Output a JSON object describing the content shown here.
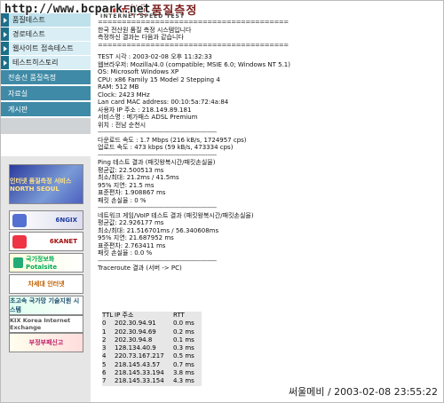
{
  "watermark": "http://www.bcpark.net",
  "logo": {
    "korean_title": "터넷 품질측정",
    "subtitle": "INTERNET SPEED TEST"
  },
  "nav": {
    "items": [
      {
        "label": "품질테스트"
      },
      {
        "label": "경로테스트"
      },
      {
        "label": "웹사이트 접속테스트"
      },
      {
        "label": "테스트히스토리"
      }
    ],
    "sections": [
      "전송선 품질측정",
      "자료실",
      "게시판"
    ]
  },
  "banners": [
    "인터넷 품질측정 서비스 NORTH SEOUL",
    "6NGIX",
    "6KANET",
    "국가정보화 Potalsite",
    "차세대 인터넷",
    "초고속 국가망 기술지원 시스템",
    "KIX Korea Internet Exchange",
    "부정부패신고"
  ],
  "content": {
    "sep": "========================================",
    "dash": "------------------------------------------------------------------",
    "intro": [
      "한국 전산원 품질 측정 시스템입니다",
      "측정하신 결과는 다음과 같습니다"
    ],
    "sysinfo": [
      "TEST 시각 : 2003-02-08 오후 11:32:33",
      "웹브라우저: Mozilla/4.0 (compatible; MSIE 6.0; Windows NT 5.1)",
      "OS: Microsoft Windows XP",
      "CPU: x86 Family 15 Model 2 Stepping 4",
      "RAM: 512 MB",
      "Clock: 2423 MHz",
      "Lan card MAC address: 00:10:5a:72:4a:84",
      "사용자 IP 주소 : 218.149.89.181",
      "서비스명 : 메가패스 ADSL Premium",
      "위치 : 전남 순천시"
    ],
    "speed": [
      "다운로드 속도 : 1.7 Mbps (216 kB/s, 1724957 cps)",
      "업로드 속도 : 473 kbps (59 kB/s, 473334 cps)"
    ],
    "ping": [
      "Ping 테스트 결과 (패킷왕복시간/패킷손실율)",
      "평균값: 22.500513 ms",
      "최소/최대: 21.2ms / 41.5ms",
      "95% 지연: 21.5 ms",
      "표준편차: 1.908867 ms",
      "패킷 손실율 : 0 %"
    ],
    "voip": [
      "네트워크 게임/VoIP 테스트 결과 (패킷왕복시간/패킷손실율)",
      "평균값: 22.926177 ms",
      "최소/최대: 21.516701ms / 56.340608ms",
      "95% 지연: 21.687952 ms",
      "표준편차: 2.763411 ms",
      "패킷 손실율 : 0.0 %"
    ],
    "traceroute_title": "Traceroute 결과 (서버 -> PC)"
  },
  "traceroute": {
    "headers": [
      "TTL",
      "IP 주소",
      "RTT"
    ],
    "rows": [
      [
        "0",
        "202.30.94.91",
        "0.0 ms"
      ],
      [
        "1",
        "202.30.94.69",
        "0.2 ms"
      ],
      [
        "2",
        "202.30.94.8",
        "0.1 ms"
      ],
      [
        "3",
        "128.134.40.9",
        "0.3 ms"
      ],
      [
        "4",
        "220.73.167.217",
        "0.5 ms"
      ],
      [
        "5",
        "218.145.43.57",
        "0.7 ms"
      ],
      [
        "6",
        "218.145.33.194",
        "3.8 ms"
      ],
      [
        "7",
        "218.145.33.154",
        "4.3 ms"
      ]
    ]
  },
  "stamp": "써울메비 / 2003-02-08 23:55:22"
}
